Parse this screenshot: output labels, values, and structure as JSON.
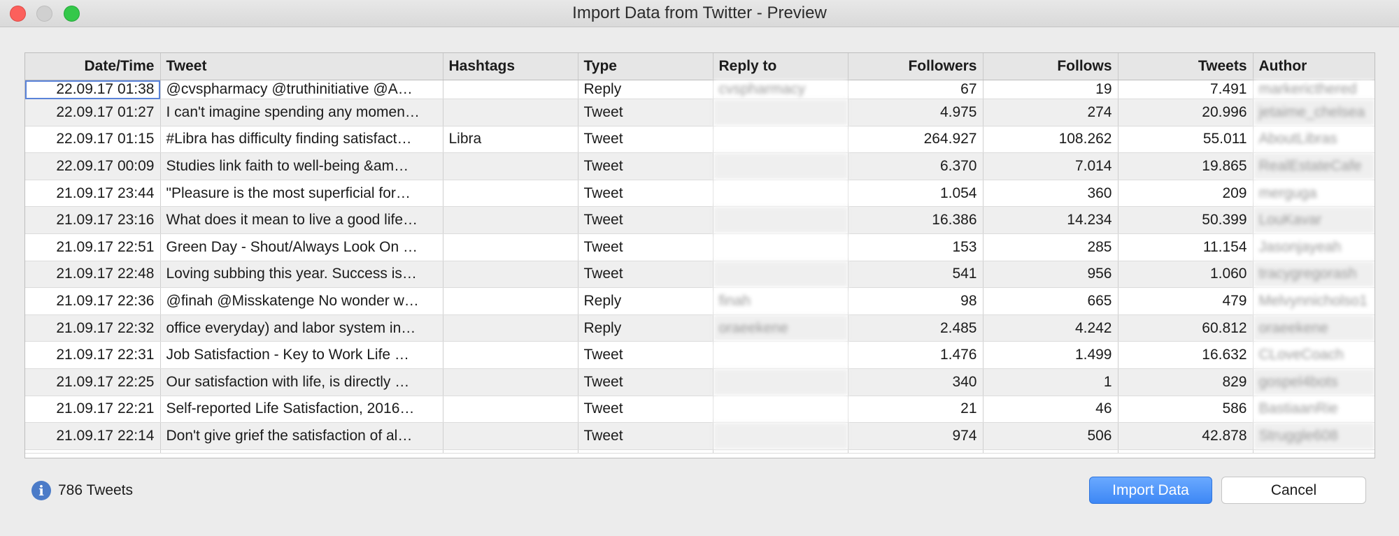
{
  "window": {
    "title": "Import Data from Twitter - Preview"
  },
  "table": {
    "headers": [
      "Date/Time",
      "Tweet",
      "Hashtags",
      "Type",
      "Reply to",
      "Followers",
      "Follows",
      "Tweets",
      "Author"
    ],
    "rows": [
      [
        "22.09.17 01:38",
        "@cvspharmacy @truthinitiative @A…",
        "",
        "Reply",
        "cvspharmacy",
        "67",
        "19",
        "7.491",
        "markericthered"
      ],
      [
        "22.09.17 01:27",
        "I can't imagine spending any momen…",
        "",
        "Tweet",
        "",
        "4.975",
        "274",
        "20.996",
        "jetaime_chelsea"
      ],
      [
        "22.09.17 01:15",
        "#Libra has difficulty finding satisfact…",
        "Libra",
        "Tweet",
        "",
        "264.927",
        "108.262",
        "55.011",
        "AboutLibras"
      ],
      [
        "22.09.17 00:09",
        "Studies link faith to well-being &am…",
        "",
        "Tweet",
        "",
        "6.370",
        "7.014",
        "19.865",
        "RealEstateCafe"
      ],
      [
        "21.09.17 23:44",
        "\"Pleasure is the most superficial for…",
        "",
        "Tweet",
        "",
        "1.054",
        "360",
        "209",
        "merguga"
      ],
      [
        "21.09.17 23:16",
        "What does it mean to live a good life…",
        "",
        "Tweet",
        "",
        "16.386",
        "14.234",
        "50.399",
        "LouKavar"
      ],
      [
        "21.09.17 22:51",
        "Green Day - Shout/Always Look On …",
        "",
        "Tweet",
        "",
        "153",
        "285",
        "11.154",
        "Jasonjayeah"
      ],
      [
        "21.09.17 22:48",
        "Loving subbing this year. Success is…",
        "",
        "Tweet",
        "",
        "541",
        "956",
        "1.060",
        "tracygregorash"
      ],
      [
        "21.09.17 22:36",
        "@finah @Misskatenge No wonder w…",
        "",
        "Reply",
        "finah",
        "98",
        "665",
        "479",
        "Melvynnicholso1"
      ],
      [
        "21.09.17 22:32",
        "office everyday) and labor system in…",
        "",
        "Reply",
        "oraeekene",
        "2.485",
        "4.242",
        "60.812",
        "oraeekene"
      ],
      [
        "21.09.17 22:31",
        "Job Satisfaction - Key to Work Life …",
        "",
        "Tweet",
        "",
        "1.476",
        "1.499",
        "16.632",
        "CLoveCoach"
      ],
      [
        "21.09.17 22:25",
        "Our satisfaction with life, is directly …",
        "",
        "Tweet",
        "",
        "340",
        "1",
        "829",
        "gospel4bots"
      ],
      [
        "21.09.17 22:21",
        "Self-reported Life Satisfaction, 2016…",
        "",
        "Tweet",
        "",
        "21",
        "46",
        "586",
        "BastiaanRie"
      ],
      [
        "21.09.17 22:14",
        "Don't give grief the satisfaction of al…",
        "",
        "Tweet",
        "",
        "974",
        "506",
        "42.878",
        "Struggle608"
      ]
    ]
  },
  "status": {
    "text": "786 Tweets",
    "icon": "info-icon"
  },
  "buttons": {
    "import": "Import Data",
    "cancel": "Cancel"
  },
  "colors": {
    "accent": "#3d87f5",
    "close": "#fc605c",
    "maximize": "#34c84a"
  }
}
